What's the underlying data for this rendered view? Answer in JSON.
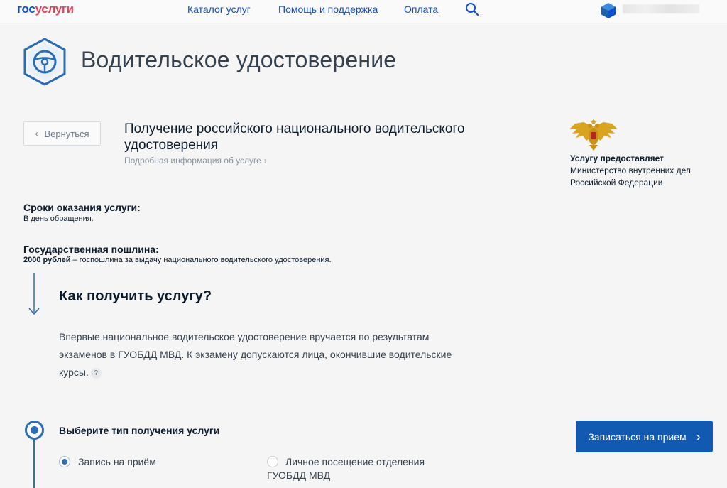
{
  "header": {
    "logo_part1": "гос",
    "logo_part2": "услуги",
    "nav": [
      "Каталог услуг",
      "Помощь и поддержка",
      "Оплата"
    ],
    "icons": {
      "search": "search-icon",
      "profile": "cube-icon"
    }
  },
  "page": {
    "title": "Водительское удостоверение",
    "icon": "steering-wheel-icon"
  },
  "service": {
    "back_label": "Вернуться",
    "name": "Получение российского национального водительского удостоверения",
    "more_label": "Подробная информация об услуге",
    "chevron": "›"
  },
  "provider": {
    "label": "Услугу предоставляет",
    "name": "Министерство внутренних дел Российской Федерации",
    "emblem": "coat-of-arms-icon"
  },
  "terms": {
    "title": "Сроки оказания услуги:",
    "text": "В день обращения."
  },
  "fee": {
    "title": "Государственная пошлина:",
    "amount": "2000 рублей",
    "text": " – госпошлина за выдачу национального водительского удостоверения."
  },
  "how": {
    "title": "Как получить услугу?",
    "text": "Впервые национальное водительское удостоверение вручается по результатам экзаменов в ГУОБДД МВД. К экзамену допускаются лица, окончившие водительские курсы.",
    "help": "?"
  },
  "step": {
    "title": "Выберите тип получения услуги",
    "options": [
      {
        "label": "Запись на приём",
        "selected": true
      },
      {
        "label": "Личное посещение отделения ГУОБДД МВД",
        "selected": false
      }
    ],
    "button_label": "Записаться на прием"
  },
  "colors": {
    "accent": "#1259b1",
    "logo_blue": "#0d4cd3",
    "logo_red": "#ee3f58"
  }
}
